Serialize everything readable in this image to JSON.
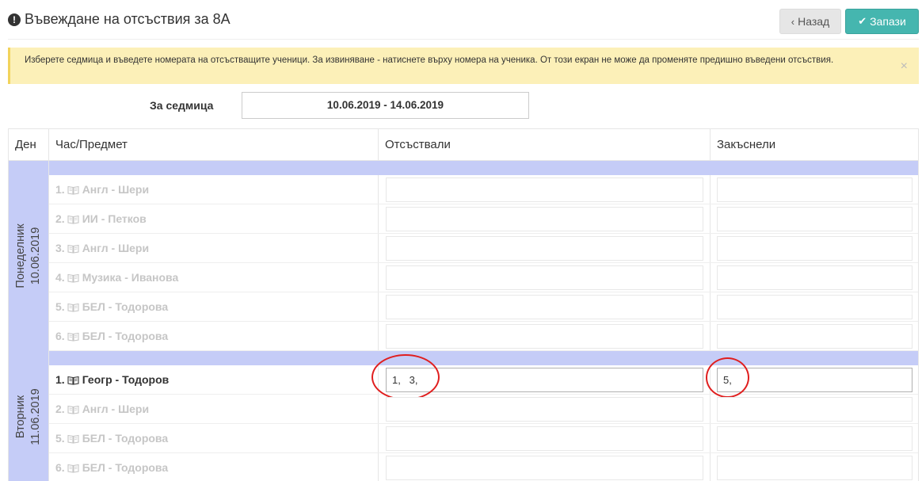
{
  "header": {
    "title": "Въвеждане на отсъствия за 8А",
    "back_label": "Назад",
    "save_label": "Запази"
  },
  "alert": {
    "text": "Изберете седмица и въведете номерата на отсъстващите ученици. За извиняване - натиснете върху номера на ученика. От този екран не може да променяте предишно въведени отсъствия.",
    "close": "×"
  },
  "week": {
    "label": "За седмица",
    "value": "10.06.2019 - 14.06.2019"
  },
  "table": {
    "headers": [
      "Ден",
      "Час/Предмет",
      "Отсъствали",
      "Закъснели"
    ],
    "days": [
      {
        "name": "Понеделник",
        "date": "10.06.2019",
        "lessons": [
          {
            "num": "1.",
            "subject": "Англ - Шери",
            "absent": "",
            "late": ""
          },
          {
            "num": "2.",
            "subject": "ИИ - Петков",
            "absent": "",
            "late": ""
          },
          {
            "num": "3.",
            "subject": "Англ - Шери",
            "absent": "",
            "late": ""
          },
          {
            "num": "4.",
            "subject": "Музика - Иванова",
            "absent": "",
            "late": ""
          },
          {
            "num": "5.",
            "subject": "БЕЛ - Тодорова",
            "absent": "",
            "late": ""
          },
          {
            "num": "6.",
            "subject": "БЕЛ - Тодорова",
            "absent": "",
            "late": ""
          }
        ]
      },
      {
        "name": "Вторник",
        "date": "11.06.2019",
        "lessons": [
          {
            "num": "1.",
            "subject": "Геогр - Тодоров",
            "absent": "1,   3,",
            "late": "5,"
          },
          {
            "num": "2.",
            "subject": "Англ - Шери",
            "absent": "",
            "late": ""
          },
          {
            "num": "5.",
            "subject": "БЕЛ - Тодорова",
            "absent": "",
            "late": ""
          },
          {
            "num": "6.",
            "subject": "БЕЛ - Тодорова",
            "absent": "",
            "late": ""
          }
        ]
      }
    ]
  },
  "icons": {
    "title": "exclamation-circle-icon",
    "back": "chevron-left-icon",
    "save": "check-icon",
    "lesson": "book-icon"
  },
  "colors": {
    "save_button": "#45b6af",
    "day_band": "#c5ccf7",
    "alert_bg": "#fcf0b8",
    "annotation": "#e01e1e"
  }
}
